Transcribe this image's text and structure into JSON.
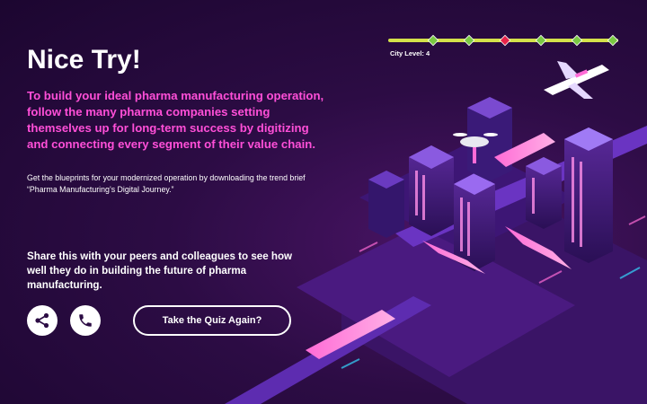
{
  "headline": "Nice Try!",
  "lead": "To build your ideal pharma manufacturing operation, follow the many pharma companies setting themselves up for long-term success by digitizing and connecting every segment of their value chain.",
  "body": "Get the blueprints for your modernized operation by downloading the trend brief “Pharma Manufacturing’s Digital Journey.”",
  "share_text": "Share this with your peers and colleagues to see how well they do in building the future of pharma manufacturing.",
  "buttons": {
    "share_icon": "share-icon",
    "phone_icon": "phone-icon",
    "quiz_label": "Take the Quiz Again?"
  },
  "city_level": {
    "label": "City Level: 4",
    "level": 4,
    "markers": 6,
    "current_marker": 2,
    "colors": {
      "track": "#d4e24a",
      "marker": "#7ac943",
      "current": "#e8234a"
    }
  },
  "colors": {
    "accent_pink": "#ff4fd8",
    "background": "#2c0c44",
    "text": "#ffffff"
  }
}
